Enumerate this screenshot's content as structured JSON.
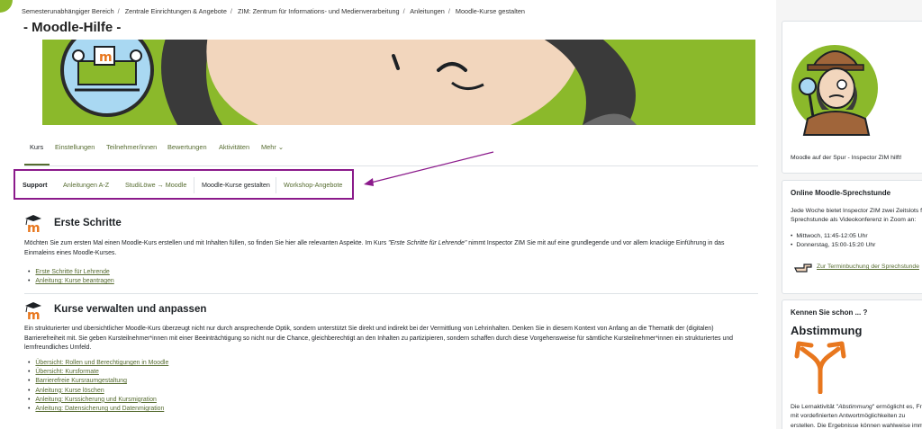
{
  "breadcrumb": [
    "Semesterunabhängiger Bereich",
    "Zentrale Einrichtungen & Angebote",
    "ZIM: Zentrum für Informations- und Medienverarbeitung",
    "Anleitungen",
    "Moodle-Kurse gestalten"
  ],
  "page": {
    "title": "- Moodle-Hilfe -"
  },
  "tabs": [
    {
      "label": "Kurs"
    },
    {
      "label": "Einstellungen"
    },
    {
      "label": "Teilnehmer/innen"
    },
    {
      "label": "Bewertungen"
    },
    {
      "label": "Aktivitäten"
    },
    {
      "label": "Mehr"
    }
  ],
  "subnav": [
    {
      "label": "Support"
    },
    {
      "label": "Anleitungen A-Z"
    },
    {
      "label": "StudiLöwe → Moodle"
    },
    {
      "label": "Moodle-Kurse gestalten"
    },
    {
      "label": "Workshop-Angebote"
    }
  ],
  "sections": [
    {
      "title": "Erste Schritte",
      "text_before": "Möchten Sie zum ersten Mal einen Moodle-Kurs erstellen und mit Inhalten füllen, so finden Sie hier alle relevanten Aspekte. Im Kurs ",
      "text_em": "\"Erste Schritte für Lehrende\"",
      "text_after": " nimmt Inspector ZIM Sie mit auf eine grundlegende und vor allem knackige Einführung in das Einmaleins eines Moodle-Kurses.",
      "links": [
        "Erste Schritte für Lehrende",
        "Anleitung: Kurse beantragen"
      ]
    },
    {
      "title": "Kurse verwalten und anpassen",
      "text": "Ein strukturierter und übersichtlicher Moodle-Kurs überzeugt nicht nur durch ansprechende Optik, sondern unterstützt Sie direkt und indirekt bei der Vermittlung von Lehrinhalten. Denken Sie in diesem Kontext von Anfang an die Thematik der (digitalen) Barrierefreiheit mit. Sie geben Kursteilnehmer*innen mit einer Beeinträchtigung so nicht nur die Chance, gleichberechtigt an den Inhalten zu partizipieren, sondern schaffen durch diese Vorgehensweise für sämtliche Kursteilnehmer*innen ein strukturiertes und lernfreundliches Umfeld.",
      "links": [
        "Übersicht: Rollen und Berechtigungen in Moodle",
        "Übersicht: Kursformate",
        "Barrierefreie Kursraumgestaltung",
        "Anleitung: Kurse löschen",
        "Anleitung: Kurssicherung und Kursmigration",
        "Anleitung: Datensicherung und Datenmigration"
      ]
    }
  ],
  "sidebar": {
    "inspector_caption": "Moodle auf der Spur - Inspector ZIM hilft!",
    "office_hours": {
      "title": "Online Moodle-Sprechstunde",
      "text_line1": "Jede Woche bietet Inspector ZIM zwei Zeitslots f",
      "text_line2": "Sprechstunde als Videokonferenz in Zoom an:",
      "slots": [
        "Mittwoch, 11:45-12:05 Uhr",
        "Donnerstag, 15:00-15:20 Uhr"
      ],
      "link": "Zur Terminbuchung der Sprechstunde"
    },
    "did_you_know": {
      "title": "Kennen Sie schon ... ?",
      "heading": "Abstimmung",
      "text_line1_before": "Die Lernaktivität \"",
      "text_line1_em": "Abstimmung",
      "text_line1_after": "\" ermöglicht es, Fr",
      "text_line2": "mit vordefinierten Antwortmöglichkeiten zu",
      "text_line3": "erstellen. Die Ergebnisse können wahlweise imm"
    }
  },
  "colors": {
    "accent": "#556b2f",
    "brand_green": "#8bb92b",
    "highlight": "#8b1a8b",
    "icon_orange": "#e8771e"
  }
}
